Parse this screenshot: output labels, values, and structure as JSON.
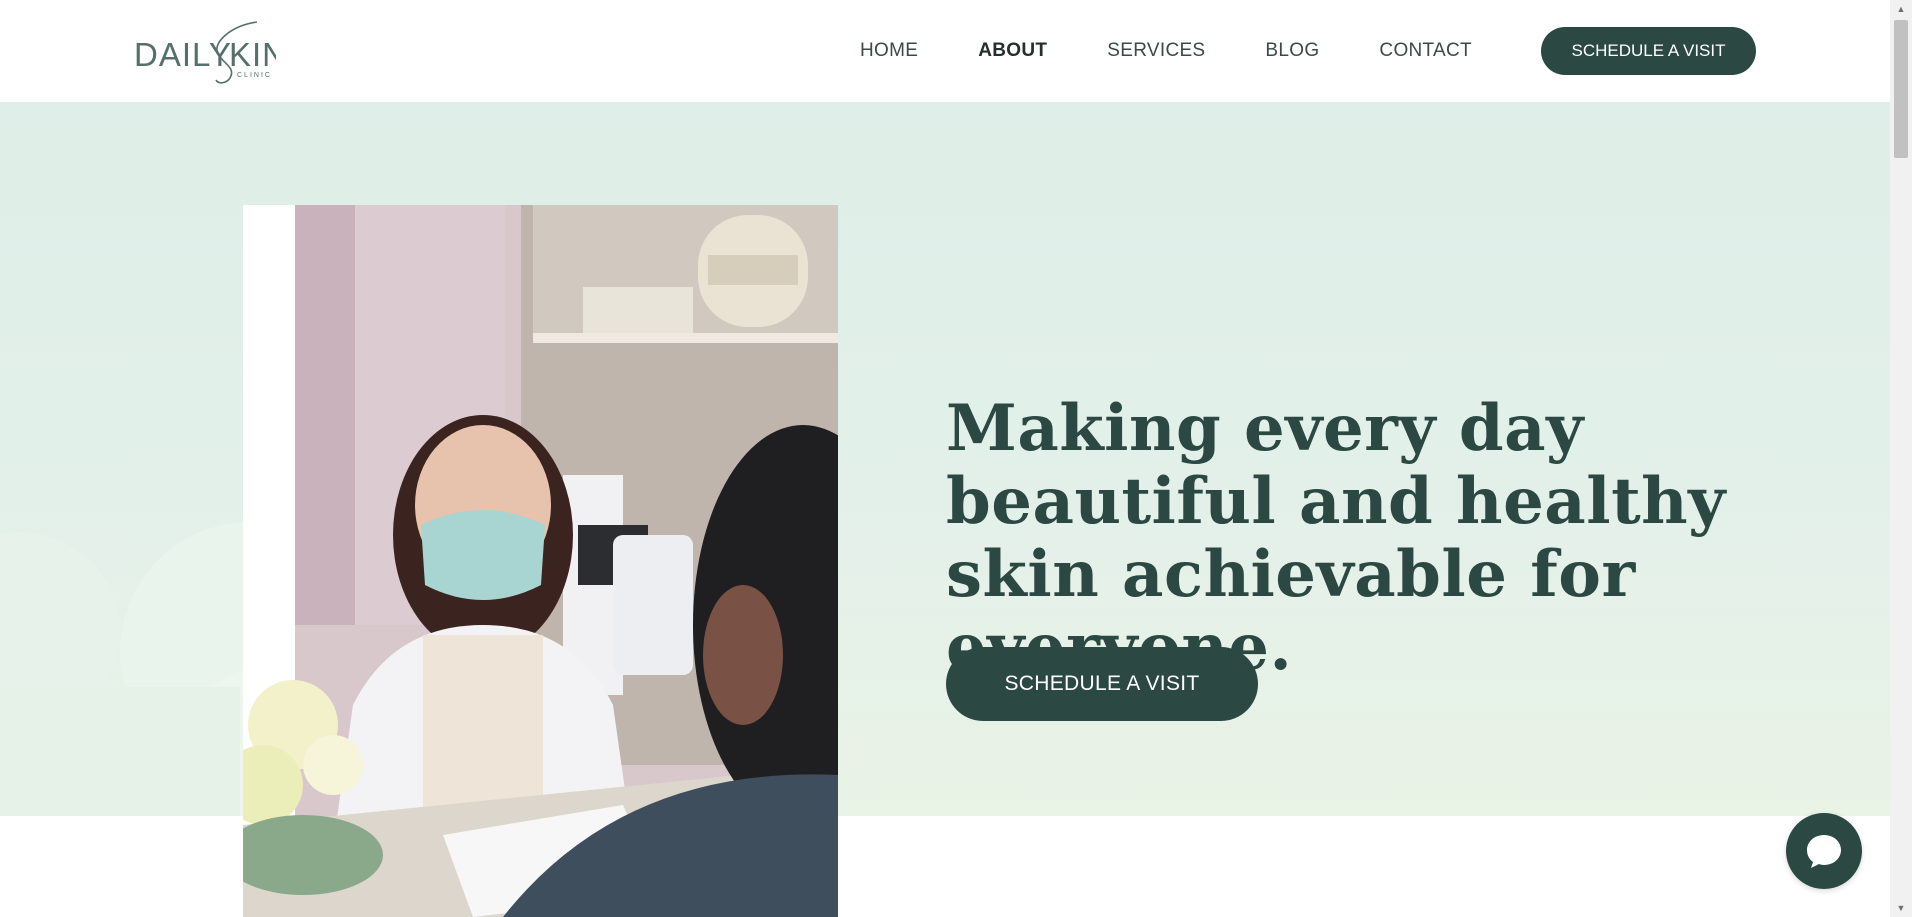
{
  "brand": {
    "name": "DAILY SKIN",
    "tagline": "CLINIC",
    "color": "#2c4842"
  },
  "nav": {
    "items": [
      {
        "label": "HOME",
        "active": false
      },
      {
        "label": "ABOUT",
        "active": true
      },
      {
        "label": "SERVICES",
        "active": false
      },
      {
        "label": "BLOG",
        "active": false
      },
      {
        "label": "CONTACT",
        "active": false
      }
    ],
    "cta_label": "SCHEDULE A VISIT"
  },
  "hero": {
    "headline": "Making every day beautiful and healthy skin achievable for everyone.",
    "cta_label": "SCHEDULE A VISIT",
    "background_color": "#dfeee8"
  },
  "chat": {
    "icon": "chat-bubble-icon"
  },
  "scrollbar": {
    "icons": [
      "scroll-up-arrow-icon",
      "scroll-down-arrow-icon"
    ]
  }
}
